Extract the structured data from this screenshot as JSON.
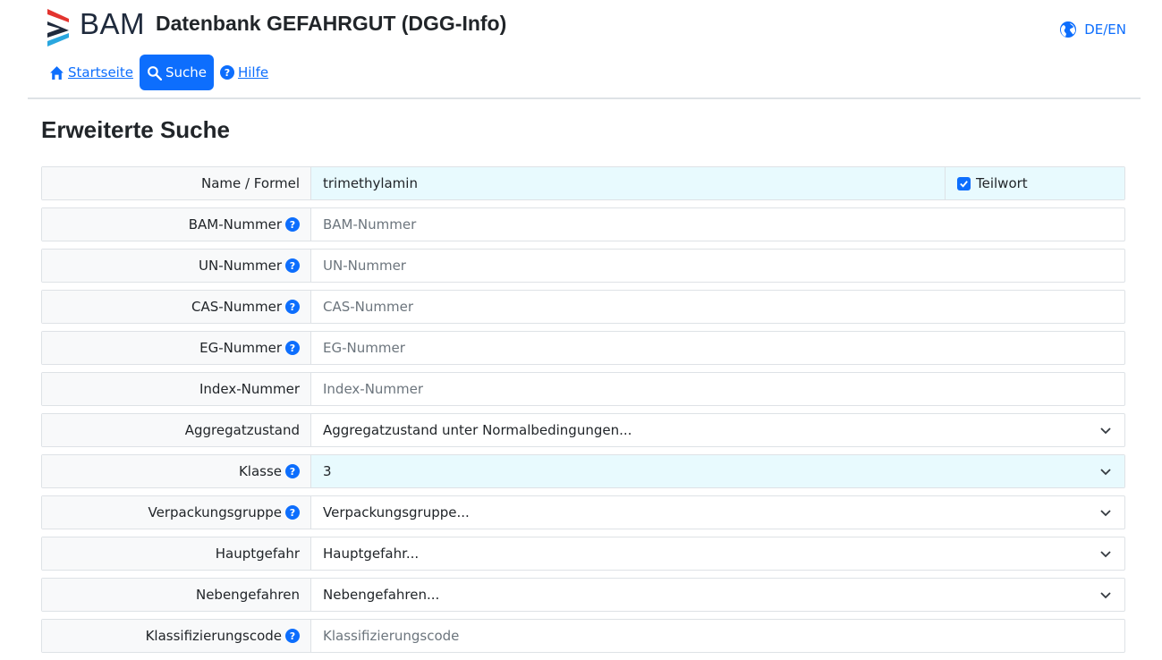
{
  "header": {
    "logo_text": "BAM",
    "app_title": "Datenbank GEFAHRGUT (DGG-Info)",
    "language_label": "DE/EN"
  },
  "nav": {
    "items": [
      {
        "label": "Startseite",
        "icon": "home-icon",
        "active": false
      },
      {
        "label": "Suche",
        "icon": "search-icon",
        "active": true
      },
      {
        "label": "Hilfe",
        "icon": "help-circle-icon",
        "active": false
      }
    ]
  },
  "page_title": "Erweiterte Suche",
  "form": {
    "name": {
      "label": "Name / Formel",
      "value": "trimethylamin",
      "teilwort_label": "Teilwort",
      "teilwort_checked": true
    },
    "bam": {
      "label": "BAM-Nummer",
      "placeholder": "BAM-Nummer"
    },
    "un": {
      "label": "UN-Nummer",
      "placeholder": "UN-Nummer"
    },
    "cas": {
      "label": "CAS-Nummer",
      "placeholder": "CAS-Nummer"
    },
    "eg": {
      "label": "EG-Nummer",
      "placeholder": "EG-Nummer"
    },
    "index": {
      "label": "Index-Nummer",
      "placeholder": "Index-Nummer"
    },
    "aggregat": {
      "label": "Aggregatzustand",
      "value": "Aggregatzustand unter Normalbedingungen..."
    },
    "klasse": {
      "label": "Klasse",
      "value": "3"
    },
    "verpackung": {
      "label": "Verpackungsgruppe",
      "value": "Verpackungsgruppe..."
    },
    "haupt": {
      "label": "Hauptgefahr",
      "value": "Hauptgefahr..."
    },
    "neben": {
      "label": "Nebengefahren",
      "value": "Nebengefahren..."
    },
    "klassifizierung": {
      "label": "Klassifizierungscode",
      "placeholder": "Klassifizierungscode"
    }
  },
  "colors": {
    "accent": "#0d6efd",
    "highlight_bg": "#e8fafe",
    "label_bg": "#f8f9fa"
  }
}
